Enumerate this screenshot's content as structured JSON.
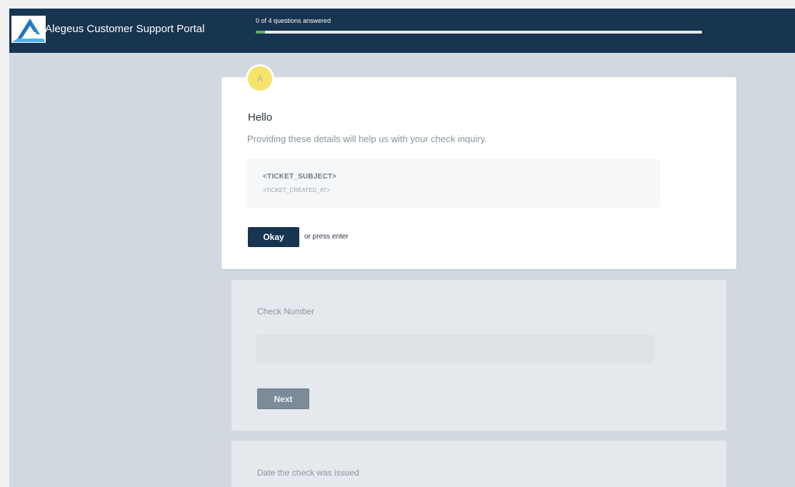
{
  "header": {
    "portal_title": "Alegeus Customer Support Portal",
    "progress_text": "0 of 4 questions answered",
    "progress_fraction": 0.02,
    "background_color": "#173450",
    "progress_color": "#58b15a"
  },
  "intro_card": {
    "avatar_letter": "A",
    "greeting": "Hello",
    "description": "Providing these details will help us with your check inquiry.",
    "ticket_subject": "<TICKET_SUBJECT>",
    "ticket_created_at": "<TICKET_CREATED_AT>",
    "okay_label": "Okay",
    "hint": "or press enter"
  },
  "questions": {
    "check_number": {
      "label": "Check Number",
      "value": "",
      "next_label": "Next"
    },
    "date_issued": {
      "label": "Date the check was issued"
    }
  },
  "icons": {
    "logo": "alegeus-logo-icon"
  }
}
